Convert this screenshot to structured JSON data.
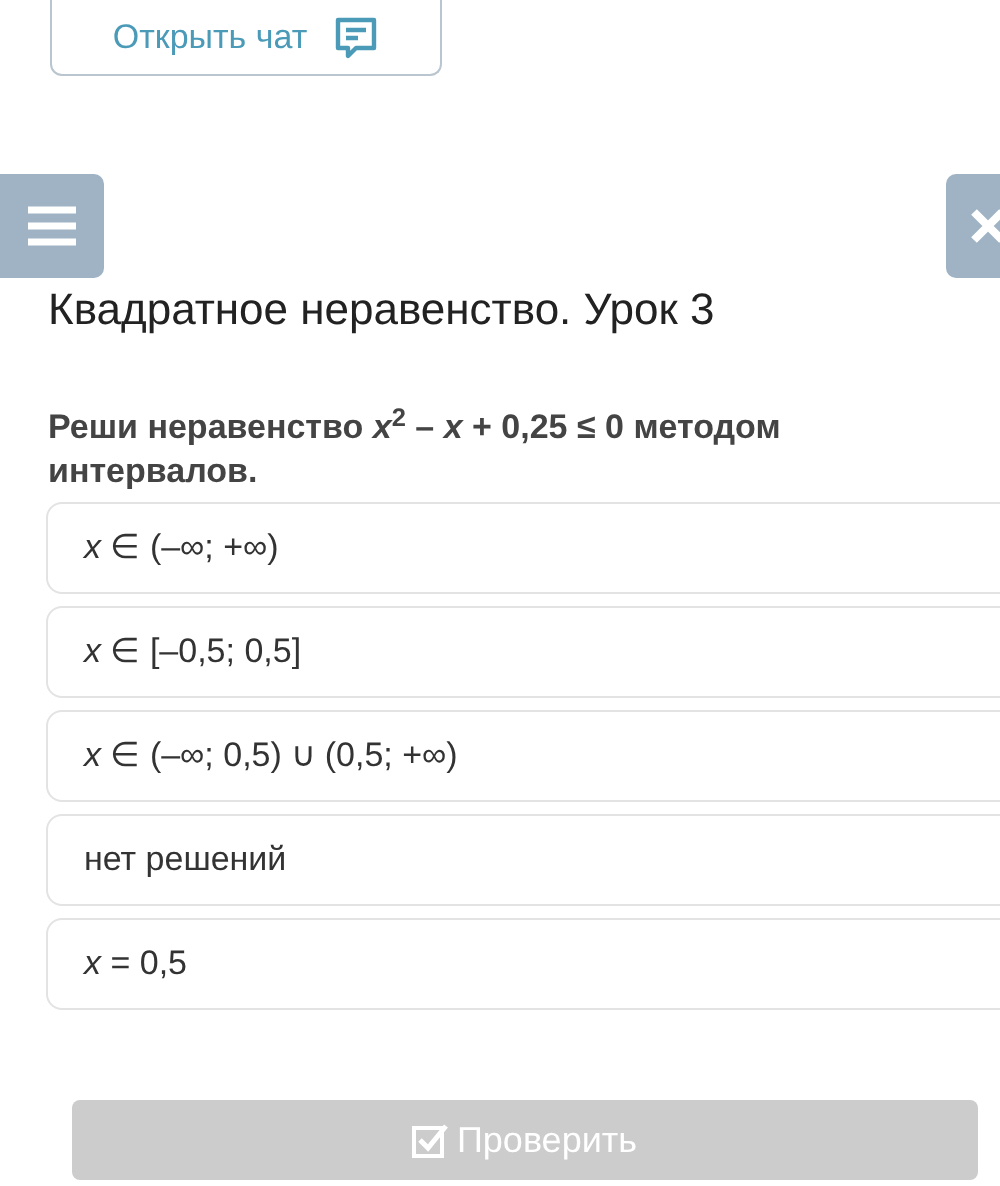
{
  "chat_button": {
    "label": "Открыть чат"
  },
  "lesson_title": "Квадратное неравенство. Урок 3",
  "question": "Реши неравенство *x*$^{2}$ – *x* + 0,25 ≤ 0 методом интервалов.",
  "options": [
    {
      "text": "*x* ∈ (–∞; +∞)",
      "selected": false
    },
    {
      "text": "*x* ∈ [–0,5; 0,5]",
      "selected": false
    },
    {
      "text": "*x* ∈ (–∞; 0,5) ∪ (0,5; +∞)",
      "selected": false
    },
    {
      "text": "нет решений",
      "selected": false
    },
    {
      "text": "*x* = 0,5",
      "selected": false
    }
  ],
  "check_button": {
    "label": "Проверить",
    "disabled": true
  }
}
